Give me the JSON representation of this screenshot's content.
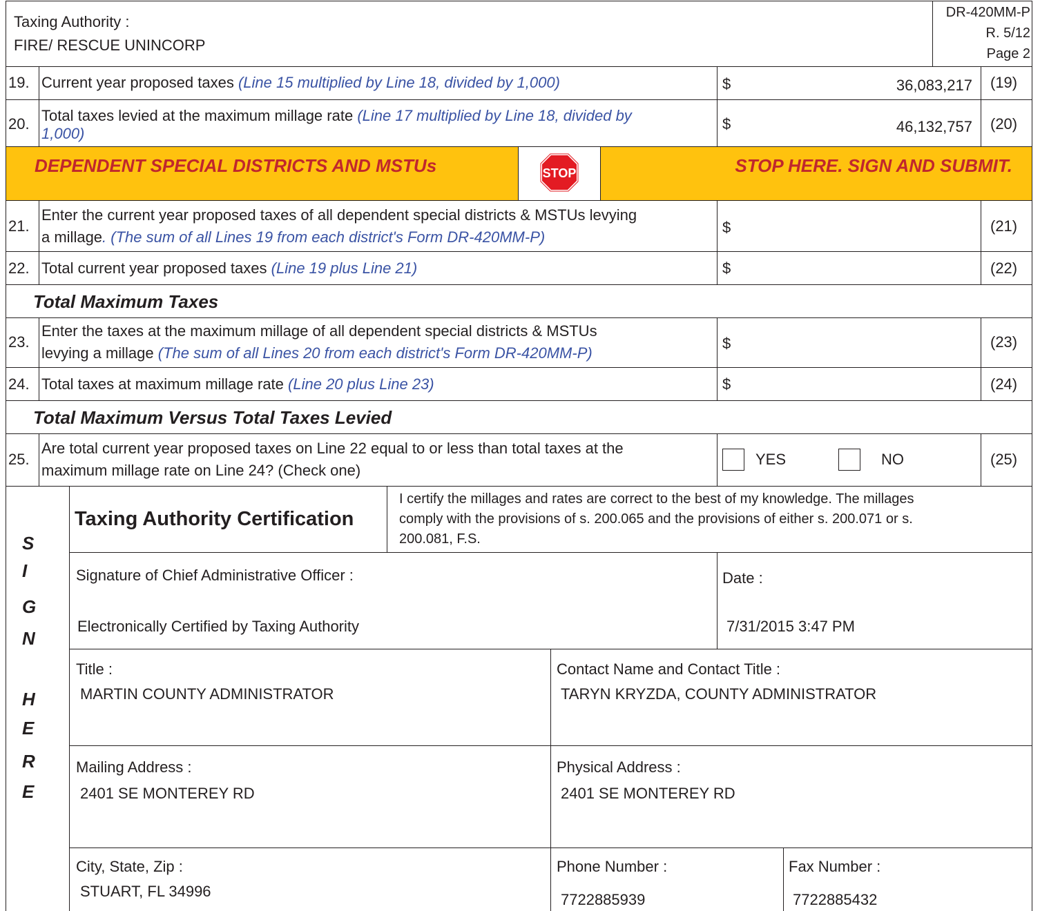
{
  "header": {
    "taxing_authority_label": "Taxing Authority :",
    "taxing_authority_value": "FIRE/ RESCUE UNINCORP",
    "form_id": "DR-420MM-P",
    "revision": "R. 5/12",
    "page": "Page 2"
  },
  "line19": {
    "num": "19.",
    "text": "Current year proposed taxes",
    "note": "(Line 15 multiplied by Line 18, divided by 1,000)",
    "dollar": "$",
    "value": "36,083,217",
    "ref": "(19)"
  },
  "line20": {
    "num": "20.",
    "text": "Total taxes levied at the maximum millage rate",
    "note_a": "(Line 17 multiplied by Line 18, divided by",
    "note_b": "1,000)",
    "dollar": "$",
    "value": "46,132,757",
    "ref": "(20)"
  },
  "banner": {
    "left": "DEPENDENT SPECIAL  DISTRICTS AND MSTUs",
    "stop_sign": "STOP",
    "right": "STOP HERE. SIGN AND SUBMIT.",
    "color": "#ffc20e"
  },
  "line21": {
    "num": "21.",
    "text_a": "Enter the current year proposed taxes of all dependent special districts & MSTUs levying",
    "text_b": "a millage",
    "note": ". (The sum of all Lines 19 from each district's Form DR-420MM-P)",
    "dollar": "$",
    "ref": "(21)"
  },
  "line22": {
    "num": "22.",
    "text": "Total current year proposed taxes",
    "note": "(Line 19 plus Line 21)",
    "dollar": "$",
    "ref": "(22)"
  },
  "section_max": "Total Maximum Taxes",
  "line23": {
    "num": "23.",
    "text_a": "Enter the taxes at the maximum millage of all dependent special districts & MSTUs",
    "text_b": "levying a millage",
    "note": "(The sum of all Lines 20 from each district's Form DR-420MM-P)",
    "dollar": "$",
    "ref": "(23)"
  },
  "line24": {
    "num": "24.",
    "text": "Total taxes at maximum millage rate",
    "note": "(Line 20 plus Line 23)",
    "dollar": "$",
    "ref": "(24)"
  },
  "section_versus": "Total Maximum Versus Total Taxes Levied",
  "line25": {
    "num": "25.",
    "text_a": "Are total current year proposed taxes on Line 22 equal to or less than total taxes at the",
    "text_b": "maximum millage rate on Line 24? (Check one)",
    "yes": "YES",
    "no": "NO",
    "ref": "(25)"
  },
  "sign_here": [
    "S",
    "I",
    "G",
    "N",
    "H",
    "E",
    "R",
    "E"
  ],
  "certification": {
    "title": "Taxing Authority Certification",
    "statement_1": "I certify the millages and rates are correct to the best of my knowledge. The millages",
    "statement_2": "comply with the provisions of s. 200.065 and the provisions of either s. 200.071 or s.",
    "statement_3": "200.081, F.S."
  },
  "signature": {
    "label": "Signature of Chief Administrative Officer :",
    "value": "Electronically Certified by Taxing Authority",
    "date_label": "Date :",
    "date_value": "7/31/2015 3:47 PM"
  },
  "title_block": {
    "label": "Title :",
    "value": "MARTIN COUNTY ADMINISTRATOR",
    "contact_label": "Contact Name and Contact Title :",
    "contact_value": "TARYN KRYZDA, COUNTY ADMINISTRATOR"
  },
  "address": {
    "mailing_label": "Mailing Address :",
    "mailing_value": "2401 SE MONTEREY RD",
    "physical_label": "Physical Address :",
    "physical_value": "2401 SE MONTEREY RD"
  },
  "contact": {
    "city_label": "City, State, Zip :",
    "city_value": "STUART, FL 34996",
    "phone_label": "Phone Number :",
    "phone_value": "7722885939",
    "fax_label": "Fax Number :",
    "fax_value": "7722885432"
  }
}
